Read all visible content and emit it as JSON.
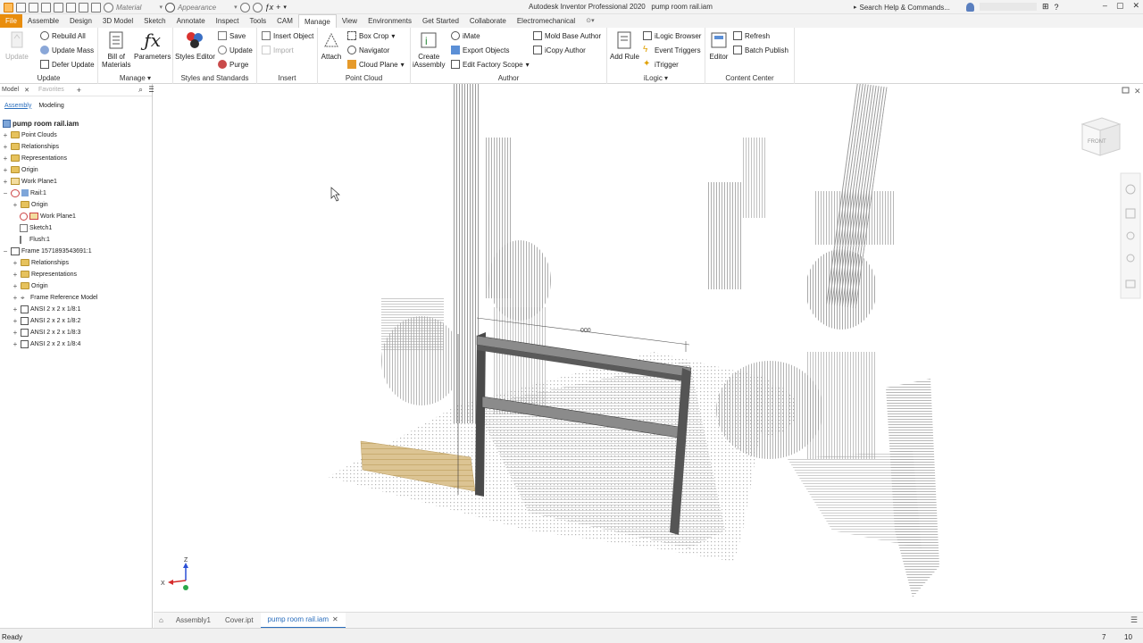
{
  "title_bar": {
    "material_label": "Material",
    "appearance_label": "Appearance",
    "app_title": "Autodesk Inventor Professional 2020",
    "doc_title": "pump room rail.iam",
    "search_placeholder": "Search Help & Commands..."
  },
  "ribbon_tabs": [
    "File",
    "Assemble",
    "Design",
    "3D Model",
    "Sketch",
    "Annotate",
    "Inspect",
    "Tools",
    "CAM",
    "Manage",
    "View",
    "Environments",
    "Get Started",
    "Collaborate",
    "Electromechanical"
  ],
  "active_tab": "Manage",
  "ribbon": {
    "update_group": {
      "big_update": "Update",
      "rebuild_all": "Rebuild All",
      "update_mass": "Update Mass",
      "defer_update": "Defer Update",
      "label": "Update"
    },
    "manage_group": {
      "bom_line1": "Bill of",
      "bom_line2": "Materials",
      "parameters": "Parameters",
      "label": "Manage"
    },
    "styles_group": {
      "styles_editor": "Styles Editor",
      "save": "Save",
      "update": "Update",
      "purge": "Purge",
      "label": "Styles and Standards"
    },
    "insert_group": {
      "insert_object": "Insert Object",
      "import": "Import",
      "label": "Insert"
    },
    "point_cloud_group": {
      "attach": "Attach",
      "box_crop": "Box Crop",
      "navigator": "Navigator",
      "cloud_plane": "Cloud Plane",
      "label": "Point Cloud"
    },
    "author_group": {
      "create_line1": "Create",
      "create_line2": "iAssembly",
      "imate": "iMate",
      "export_objects": "Export Objects",
      "edit_factory_scope": "Edit Factory Scope",
      "mold_base_author": "Mold Base Author",
      "icopy_author": "iCopy Author",
      "label": "Author"
    },
    "ilogic_group": {
      "add_rule": "Add Rule",
      "ilogic_browser": "iLogic Browser",
      "event_triggers": "Event Triggers",
      "itrigger": "iTrigger",
      "label": "iLogic"
    },
    "content_center_group": {
      "editor": "Editor",
      "refresh": "Refresh",
      "batch_publish": "Batch Publish",
      "label": "Content Center"
    }
  },
  "browser": {
    "tab_model": "Model",
    "tab_favorites": "Favorites",
    "sub_assembly": "Assembly",
    "sub_modeling": "Modeling",
    "root": "pump room rail.iam",
    "nodes": [
      "Point Clouds",
      "Relationships",
      "Representations",
      "Origin",
      "Work Plane1",
      "Rail:1",
      "Origin",
      "Work Plane1",
      "Sketch1",
      "Flush:1",
      "Frame 1571893543691:1",
      "Relationships",
      "Representations",
      "Origin",
      "Frame Reference Model",
      "ANSI 2 x 2 x 1/8:1",
      "ANSI 2 x 2 x 1/8:2",
      "ANSI 2 x 2 x 1/8:3",
      "ANSI 2 x 2 x 1/8:4"
    ]
  },
  "viewport": {
    "viewcube_face": "FRONT",
    "dimension_label": "000",
    "axis_z": "Z",
    "axis_x": "X"
  },
  "doc_tabs": [
    "Assembly1",
    "Cover.ipt",
    "pump room rail.iam"
  ],
  "status": {
    "text": "Ready",
    "count1": "7",
    "count2": "10"
  },
  "colors": {
    "file_tab": "#e98d0c",
    "accent_blue": "#2a6ebd",
    "folder": "#e6c25d",
    "block": "#d9bf86"
  }
}
